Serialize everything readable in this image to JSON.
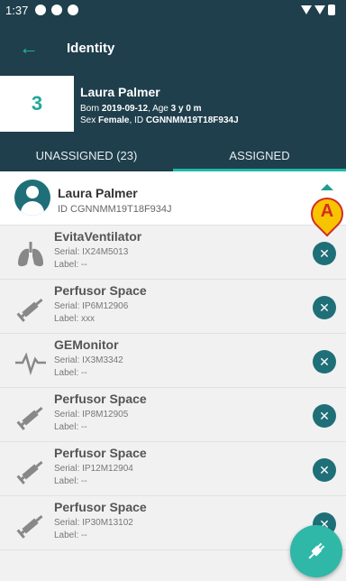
{
  "status": {
    "time": "1:37"
  },
  "appbar": {
    "back": "←",
    "title": "Identity"
  },
  "patient": {
    "bed": "3",
    "name": "Laura Palmer",
    "born_prefix": "Born ",
    "born_date": "2019-09-12",
    "age_prefix": ", Age ",
    "age": "3 y 0 m",
    "sex_prefix": "Sex ",
    "sex": "Female",
    "id_prefix": ", ID ",
    "id": "CGNNMM19T18F934J"
  },
  "tabs": [
    {
      "label": "UNASSIGNED (23)"
    },
    {
      "label": "ASSIGNED"
    }
  ],
  "assigned_patient": {
    "name": "Laura Palmer",
    "id": "ID CGNNMM19T18F934J"
  },
  "marker": {
    "letter": "A"
  },
  "devices": [
    {
      "name": "EvitaVentilator",
      "serial": "Serial: IX24M5013",
      "label": "Label: --",
      "icon": "lungs-icon"
    },
    {
      "name": "Perfusor Space",
      "serial": "Serial: IP6M12906",
      "label": "Label: xxx",
      "icon": "syringe-icon"
    },
    {
      "name": "GEMonitor",
      "serial": "Serial: IX3M3342",
      "label": "Label: --",
      "icon": "heartbeat-icon"
    },
    {
      "name": "Perfusor Space",
      "serial": "Serial: IP8M12905",
      "label": "Label: --",
      "icon": "syringe-icon"
    },
    {
      "name": "Perfusor Space",
      "serial": "Serial: IP12M12904",
      "label": "Label: --",
      "icon": "syringe-icon"
    },
    {
      "name": "Perfusor Space",
      "serial": "Serial: IP30M13102",
      "label": "Label: --",
      "icon": "syringe-icon"
    }
  ],
  "remove_glyph": "✕",
  "colors": {
    "header": "#1f3f4c",
    "accent": "#2fb8a8",
    "remove": "#1f6f78",
    "marker_fill": "#f8c400",
    "marker_border": "#d12b2b"
  }
}
